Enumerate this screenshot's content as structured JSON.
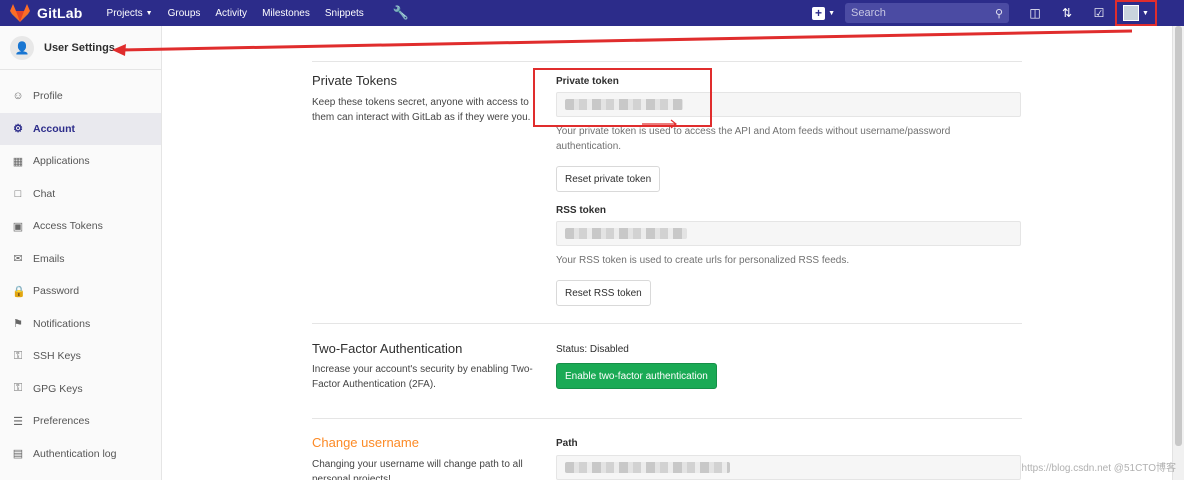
{
  "navbar": {
    "brand": "GitLab",
    "links": [
      "Projects",
      "Groups",
      "Activity",
      "Milestones",
      "Snippets"
    ],
    "search_placeholder": "Search"
  },
  "sidebar": {
    "title": "User Settings",
    "items": [
      {
        "label": "Profile",
        "icon": "profile-icon"
      },
      {
        "label": "Account",
        "icon": "account-icon",
        "active": true
      },
      {
        "label": "Applications",
        "icon": "applications-icon"
      },
      {
        "label": "Chat",
        "icon": "chat-icon"
      },
      {
        "label": "Access Tokens",
        "icon": "access-tokens-icon"
      },
      {
        "label": "Emails",
        "icon": "email-icon"
      },
      {
        "label": "Password",
        "icon": "lock-icon"
      },
      {
        "label": "Notifications",
        "icon": "bell-icon"
      },
      {
        "label": "SSH Keys",
        "icon": "key-icon"
      },
      {
        "label": "GPG Keys",
        "icon": "key-icon"
      },
      {
        "label": "Preferences",
        "icon": "sliders-icon"
      },
      {
        "label": "Authentication log",
        "icon": "log-icon"
      }
    ]
  },
  "private_tokens": {
    "title": "Private Tokens",
    "description": "Keep these tokens secret, anyone with access to them can interact with GitLab as if they were you.",
    "private_token_label": "Private token",
    "private_token_help": "Your private token is used to access the API and Atom feeds without username/password authentication.",
    "reset_private_label": "Reset private token",
    "rss_token_label": "RSS token",
    "rss_token_help": "Your RSS token is used to create urls for personalized RSS feeds.",
    "reset_rss_label": "Reset RSS token"
  },
  "two_factor": {
    "title": "Two-Factor Authentication",
    "description": "Increase your account's security by enabling Two-Factor Authentication (2FA).",
    "status": "Status: Disabled",
    "enable_label": "Enable two-factor authentication"
  },
  "change_username": {
    "title": "Change username",
    "description": "Changing your username will change path to all personal projects!",
    "path_label": "Path"
  },
  "watermark": "https://blog.csdn.net @51CTO博客",
  "colors": {
    "navbar": "#2c2c8a",
    "accent_orange": "#fc8a26",
    "success": "#1aaa55",
    "annotation": "#e02d2d"
  }
}
